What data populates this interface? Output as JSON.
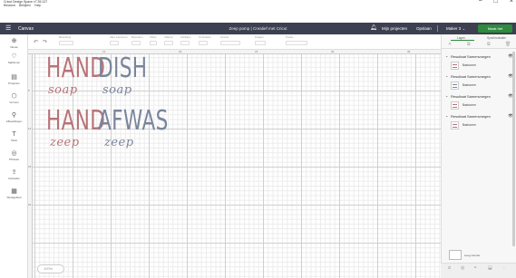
{
  "window": {
    "title": "Cricut Design Space  v7.35.127",
    "menu": [
      "Bestand",
      "Bekijken",
      "Help"
    ],
    "controls": [
      "−",
      "□",
      "×"
    ]
  },
  "header": {
    "menu_icon": "hamburger-icon",
    "section": "Canvas",
    "project_title": "Zeep pomp | Creatief met Cricut",
    "bell_icon": "bell-icon",
    "my_projects": "Mijn projecten",
    "save": "Opslaan",
    "machine": "Maker 3 ⌄",
    "make_button": "Maak het",
    "accent": "#2e8b3e"
  },
  "sidebar": {
    "items": [
      {
        "icon": "⊕",
        "label": "Nieuw"
      },
      {
        "icon": "♡",
        "label": "Sjablonen"
      },
      {
        "icon": "▤",
        "label": "Projecten"
      },
      {
        "icon": "⬡",
        "label": "Vormen"
      },
      {
        "icon": "⚲",
        "label": "Afbeeldingen"
      },
      {
        "icon": "T",
        "label": "Tekst"
      },
      {
        "icon": "◎",
        "label": "Phrases"
      },
      {
        "icon": "⇪",
        "label": "Uploaden"
      },
      {
        "icon": "▦",
        "label": "Werkgebied"
      }
    ]
  },
  "toolbar": {
    "undo_icon": "↶",
    "redo_icon": "↷",
    "groups": [
      "Bewerking",
      "Alles selecteren",
      "Bewerken",
      "Offset",
      "Uitlijnen",
      "Schikken",
      "Omdraaien",
      "Grootte",
      "Draaien",
      "Positie"
    ]
  },
  "ruler": {
    "top": [
      "12",
      "18",
      "24",
      "30",
      "36"
    ],
    "left": [
      "6",
      "12",
      "18",
      "24"
    ]
  },
  "canvas": {
    "words": [
      {
        "text": "HAND",
        "color": "#b87377"
      },
      {
        "text": "DISH",
        "color": "#7a859c"
      },
      {
        "text": "HAND",
        "color": "#b87377"
      },
      {
        "text": "AFWAS",
        "color": "#7a859c"
      }
    ],
    "scripts": [
      {
        "text": "soap",
        "color": "#b87377"
      },
      {
        "text": "soap",
        "color": "#7a859c"
      },
      {
        "text": "zeep",
        "color": "#b87377"
      },
      {
        "text": "zeep",
        "color": "#7a859c"
      }
    ],
    "zoom": "100%"
  },
  "panel": {
    "tabs": [
      "Lagen",
      "Synchronisatie"
    ],
    "groups": [
      {
        "name": "Resultaat Samenvoegen",
        "layer": "Basisvorm"
      },
      {
        "name": "Resultaat Samenvoegen",
        "layer": "Basisvorm"
      },
      {
        "name": "Resultaat Samenvoegen",
        "layer": "Basisvorm"
      },
      {
        "name": "Resultaat Samenvoegen",
        "layer": "Basisvorm"
      }
    ],
    "blank_canvas": "Leeg canvas"
  }
}
